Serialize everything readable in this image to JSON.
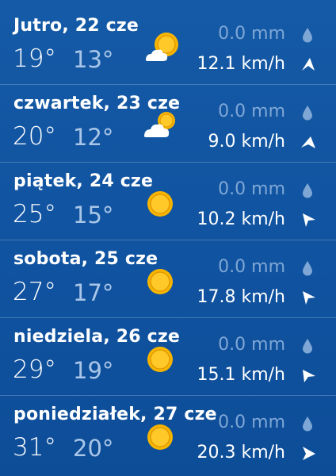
{
  "units": {
    "precip": "mm",
    "wind": "km/h"
  },
  "colors": {
    "background": "#1053a0",
    "sun": "#f7b500",
    "muted_text": "#a9c6e8",
    "precip_text": "#7fa7d6"
  },
  "forecast": [
    {
      "day": "Jutro, 22 cze",
      "high": "19°",
      "low": "13°",
      "icon": "partly-cloudy-icon",
      "precip": "0.0 mm",
      "wind": "12.1 km/h",
      "wind_dir_icon": "wind-arrow-icon"
    },
    {
      "day": "czwartek, 23 cze",
      "high": "20°",
      "low": "12°",
      "icon": "partly-cloudy-icon",
      "precip": "0.0 mm",
      "wind": "9.0 km/h",
      "wind_dir_icon": "wind-arrow-icon"
    },
    {
      "day": "piątek, 24 cze",
      "high": "25°",
      "low": "15°",
      "icon": "sun-icon",
      "precip": "0.0 mm",
      "wind": "10.2 km/h",
      "wind_dir_icon": "wind-arrow-icon"
    },
    {
      "day": "sobota, 25 cze",
      "high": "27°",
      "low": "17°",
      "icon": "sun-icon",
      "precip": "0.0 mm",
      "wind": "17.8 km/h",
      "wind_dir_icon": "wind-arrow-icon"
    },
    {
      "day": "niedziela, 26 cze",
      "high": "29°",
      "low": "19°",
      "icon": "sun-icon",
      "precip": "0.0 mm",
      "wind": "15.1 km/h",
      "wind_dir_icon": "wind-arrow-icon"
    },
    {
      "day": "poniedziałek, 27 cze",
      "high": "31°",
      "low": "20°",
      "icon": "sun-icon",
      "precip": "0.0 mm",
      "wind": "20.3 km/h",
      "wind_dir_icon": "wind-arrow-icon"
    }
  ]
}
